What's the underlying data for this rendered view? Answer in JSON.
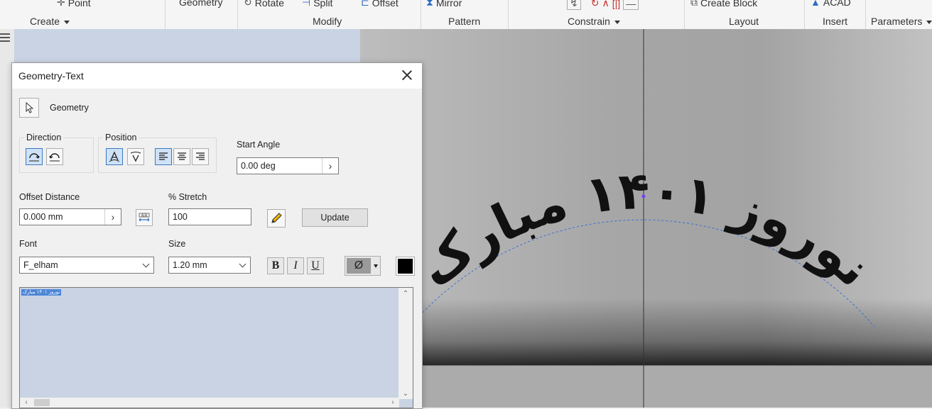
{
  "ribbon": {
    "top_items": {
      "point": "Point",
      "geometry": "Geometry",
      "rotate": "Rotate",
      "split": "Split",
      "offset": "Offset",
      "mirror": "Mirror",
      "create_block": "Create Block",
      "acad": "ACAD"
    },
    "panels": {
      "create": "Create",
      "modify": "Modify",
      "pattern": "Pattern",
      "constrain": "Constrain",
      "layout": "Layout",
      "insert": "Insert",
      "parameters": "Parameters"
    }
  },
  "dialog": {
    "title": "Geometry-Text",
    "geometry_label": "Geometry",
    "direction": {
      "title": "Direction"
    },
    "position": {
      "title": "Position"
    },
    "start_angle": {
      "label": "Start Angle",
      "value": "0.00 deg"
    },
    "offset_distance": {
      "label": "Offset Distance",
      "value": "0.000 mm"
    },
    "stretch": {
      "label": "% Stretch",
      "value": "100"
    },
    "update_label": "Update",
    "font": {
      "label": "Font",
      "value": "F_elham"
    },
    "size": {
      "label": "Size",
      "value": "1.20 mm"
    },
    "format": {
      "bold": "B",
      "italic": "I",
      "underline": "U",
      "symbol": "Ø"
    },
    "text_content": "نوروز ۱۴۰۱ مبارک"
  },
  "canvas": {
    "arc_text": "نوروز ۱۴۰۱ مبارک"
  },
  "colors": {
    "panel_blue": "#c9d3e3",
    "selection_blue": "#4d86d6",
    "text_color_swatch": "#000000",
    "arc_color": "#3a6fd8"
  }
}
